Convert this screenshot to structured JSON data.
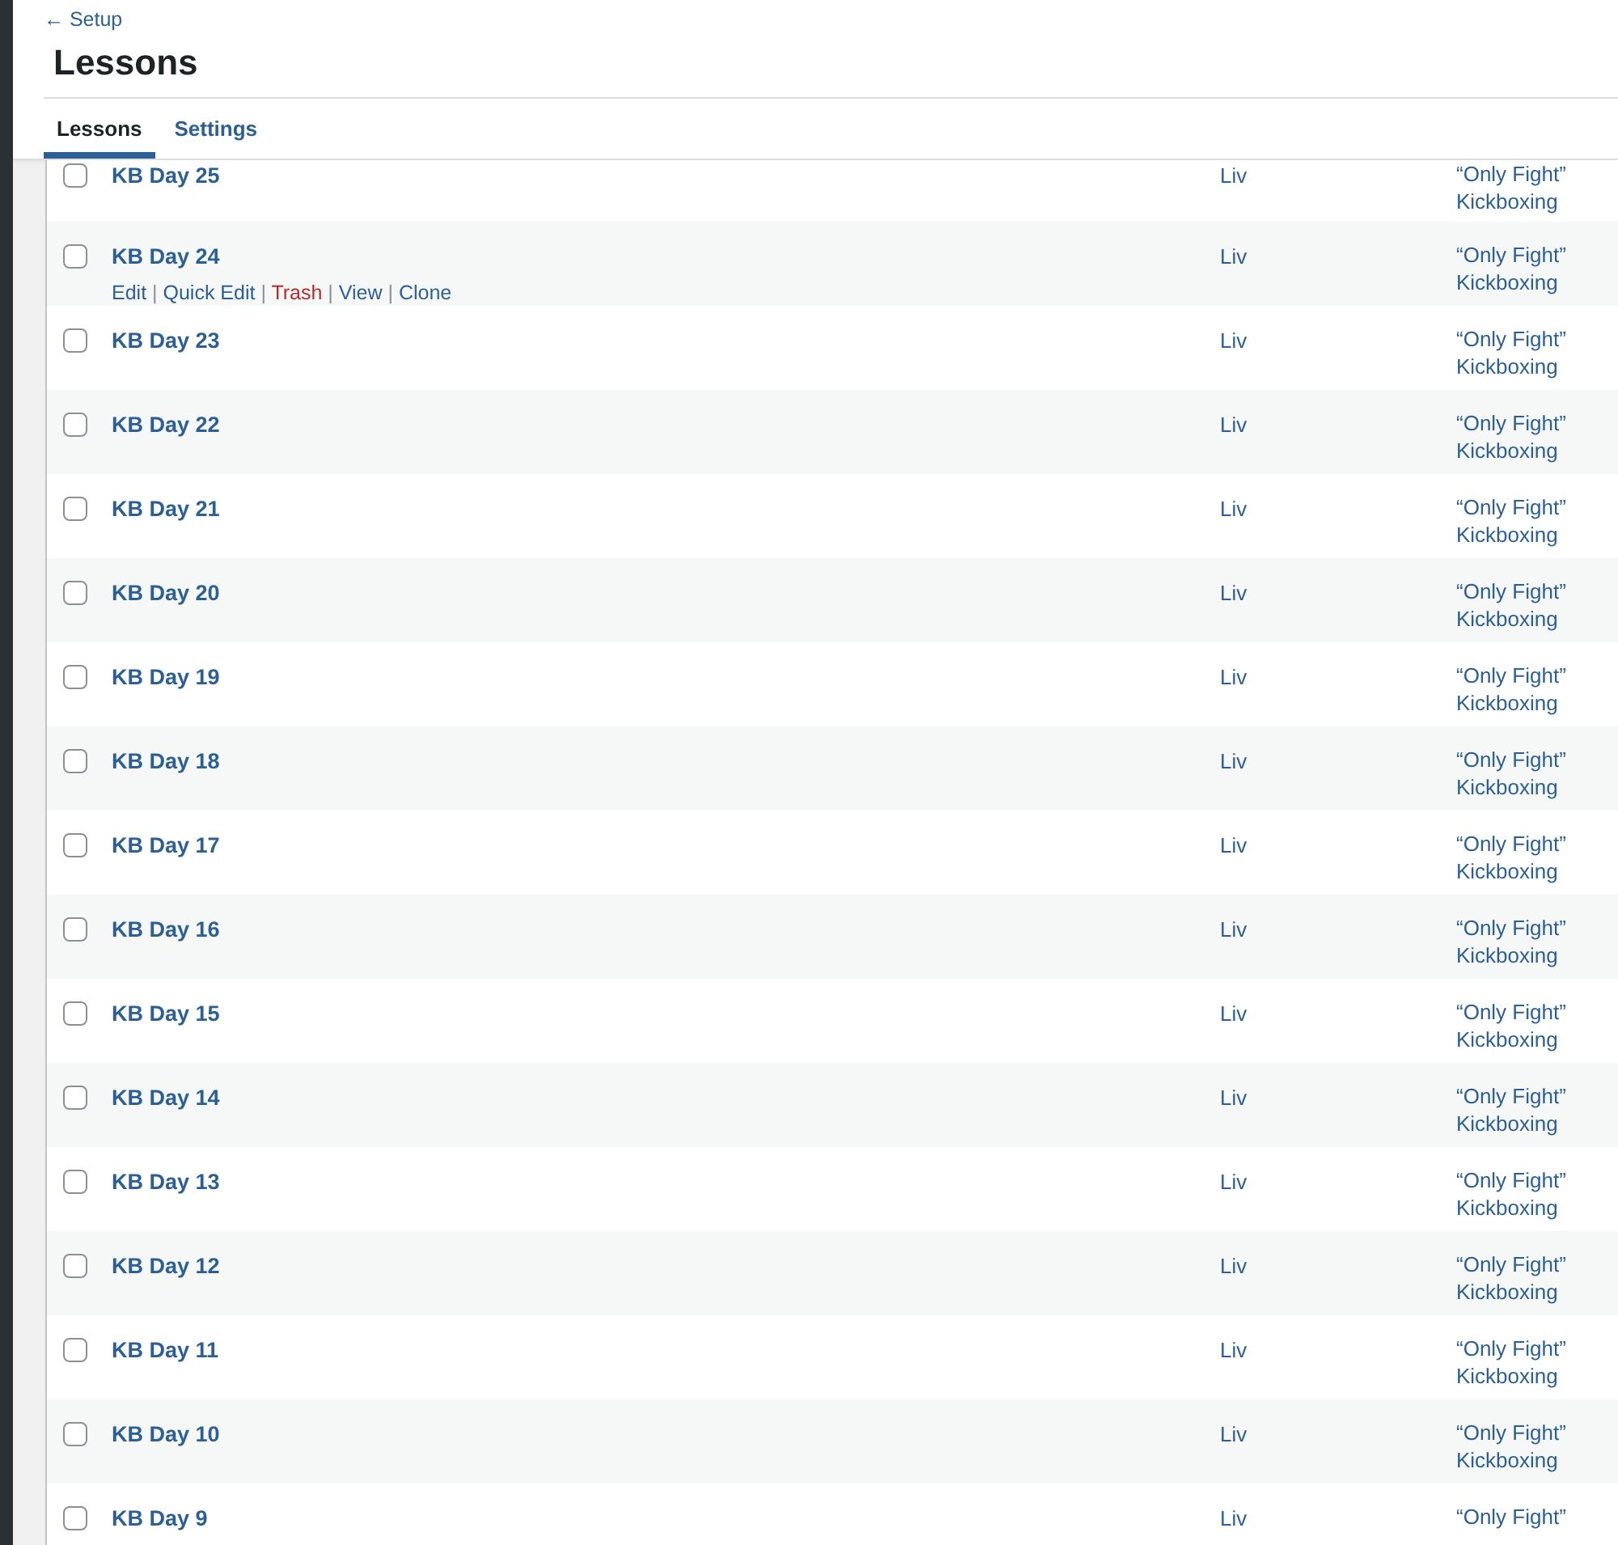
{
  "back_link": "← Setup",
  "title": "Lessons",
  "action_separator": "|",
  "tabs": [
    {
      "label": "Lessons",
      "selected": true
    },
    {
      "label": "Settings",
      "selected": false
    }
  ],
  "rows": [
    {
      "title": "KB Day 25",
      "checked": false,
      "author": "Liv",
      "category": "“Only Fight” Kickboxing"
    },
    {
      "title": "KB Day 24",
      "checked": false,
      "author": "Liv",
      "category": "“Only Fight” Kickboxing",
      "actions": [
        {
          "label": "Edit",
          "kind": "normal"
        },
        {
          "label": "Quick Edit",
          "kind": "normal"
        },
        {
          "label": "Trash",
          "kind": "trash"
        },
        {
          "label": "View",
          "kind": "normal"
        },
        {
          "label": "Clone",
          "kind": "normal"
        }
      ]
    },
    {
      "title": "KB Day 23",
      "checked": false,
      "author": "Liv",
      "category": "“Only Fight” Kickboxing"
    },
    {
      "title": "KB Day 22",
      "checked": false,
      "author": "Liv",
      "category": "“Only Fight” Kickboxing"
    },
    {
      "title": "KB Day 21",
      "checked": false,
      "author": "Liv",
      "category": "“Only Fight” Kickboxing"
    },
    {
      "title": "KB Day 20",
      "checked": false,
      "author": "Liv",
      "category": "“Only Fight” Kickboxing"
    },
    {
      "title": "KB Day 19",
      "checked": false,
      "author": "Liv",
      "category": "“Only Fight” Kickboxing"
    },
    {
      "title": "KB Day 18",
      "checked": false,
      "author": "Liv",
      "category": "“Only Fight” Kickboxing"
    },
    {
      "title": "KB Day 17",
      "checked": false,
      "author": "Liv",
      "category": "“Only Fight” Kickboxing"
    },
    {
      "title": "KB Day 16",
      "checked": false,
      "author": "Liv",
      "category": "“Only Fight” Kickboxing"
    },
    {
      "title": "KB Day 15",
      "checked": false,
      "author": "Liv",
      "category": "“Only Fight” Kickboxing"
    },
    {
      "title": "KB Day 14",
      "checked": false,
      "author": "Liv",
      "category": "“Only Fight” Kickboxing"
    },
    {
      "title": "KB Day 13",
      "checked": false,
      "author": "Liv",
      "category": "“Only Fight” Kickboxing"
    },
    {
      "title": "KB Day 12",
      "checked": false,
      "author": "Liv",
      "category": "“Only Fight” Kickboxing"
    },
    {
      "title": "KB Day 11",
      "checked": false,
      "author": "Liv",
      "category": "“Only Fight” Kickboxing"
    },
    {
      "title": "KB Day 10",
      "checked": false,
      "author": "Liv",
      "category": "“Only Fight” Kickboxing"
    },
    {
      "title": "KB Day 9",
      "checked": false,
      "author": "Liv",
      "category": "“Only Fight”"
    }
  ]
}
